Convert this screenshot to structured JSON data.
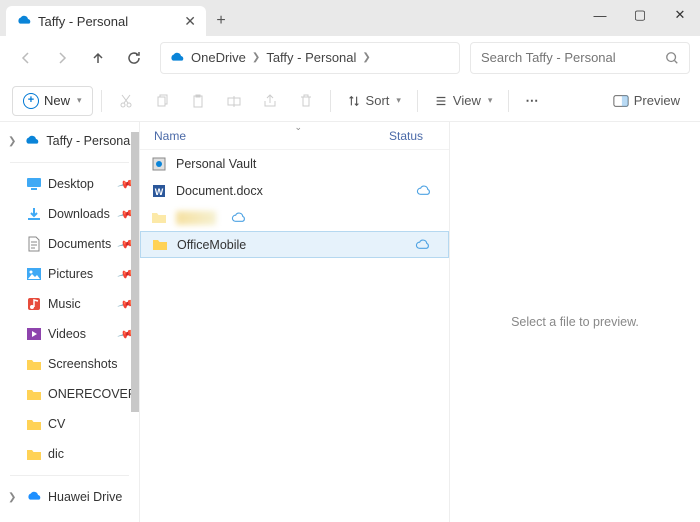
{
  "window": {
    "tab_title": "Taffy - Personal",
    "min": "—",
    "max": "▢",
    "close": "✕",
    "newtab": "+"
  },
  "nav": {
    "breadcrumb": [
      "OneDrive",
      "Taffy - Personal"
    ],
    "search_placeholder": "Search Taffy - Personal"
  },
  "toolbar": {
    "new_label": "New",
    "sort_label": "Sort",
    "view_label": "View",
    "more_label": "⋯",
    "preview_label": "Preview"
  },
  "sidebar": {
    "root": "Taffy - Personal",
    "quick": [
      {
        "label": "Desktop",
        "pinned": true,
        "icon": "desktop"
      },
      {
        "label": "Downloads",
        "pinned": true,
        "icon": "downloads"
      },
      {
        "label": "Documents",
        "pinned": true,
        "icon": "documents"
      },
      {
        "label": "Pictures",
        "pinned": true,
        "icon": "pictures"
      },
      {
        "label": "Music",
        "pinned": true,
        "icon": "music"
      },
      {
        "label": "Videos",
        "pinned": true,
        "icon": "videos"
      },
      {
        "label": "Screenshots",
        "pinned": false,
        "icon": "folder"
      },
      {
        "label": "ONERECOVERH",
        "pinned": false,
        "icon": "folder"
      },
      {
        "label": "CV",
        "pinned": false,
        "icon": "folder"
      },
      {
        "label": "dic",
        "pinned": false,
        "icon": "folder"
      }
    ],
    "bottom": "Huawei Drive"
  },
  "columns": {
    "name": "Name",
    "status": "Status"
  },
  "files": [
    {
      "name": "Personal Vault",
      "icon": "vault",
      "status": ""
    },
    {
      "name": "Document.docx",
      "icon": "word",
      "status": "cloud"
    },
    {
      "name": "",
      "icon": "folder-dim",
      "status": "cloud",
      "blurred": true
    },
    {
      "name": "OfficeMobile",
      "icon": "folder",
      "status": "cloud",
      "selected": true
    }
  ],
  "preview": {
    "empty": "Select a file to preview."
  }
}
